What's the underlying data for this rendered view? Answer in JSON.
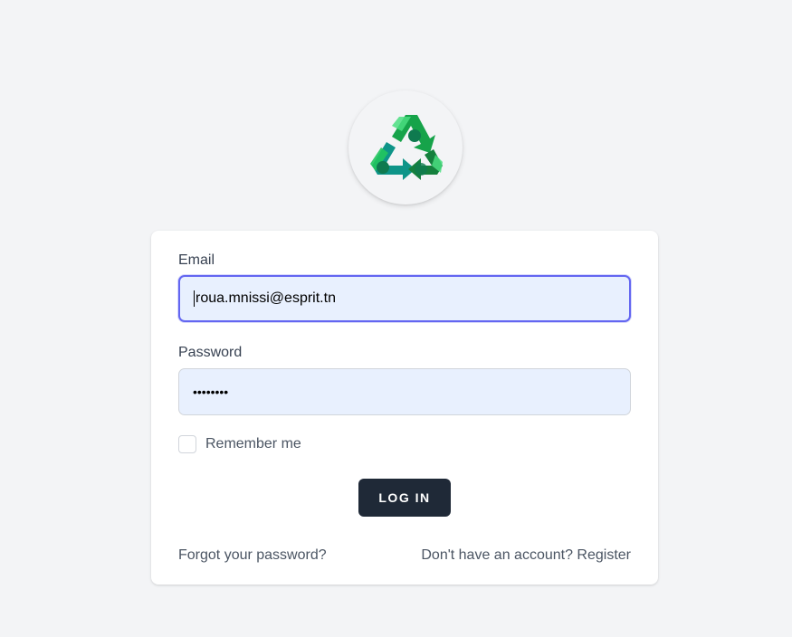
{
  "logo": {
    "icon": "recycle-icon",
    "colors": {
      "dark_green": "#0f7a4f",
      "mid_green": "#16a34a",
      "light_green": "#4ade80",
      "teal": "#0d9488"
    }
  },
  "form": {
    "email_label": "Email",
    "email_value": "roua.mnissi@esprit.tn",
    "password_label": "Password",
    "password_value": "••••••••",
    "remember_label": "Remember me",
    "remember_checked": false,
    "login_label": "LOG IN",
    "forgot_label": "Forgot your password?",
    "register_label": "Don't have an account? Register"
  },
  "colors": {
    "background": "#f3f4f6",
    "card": "#ffffff",
    "input_fill": "#e8f0fe",
    "focus_ring": "#6366f1",
    "button": "#1f2937",
    "text_label": "#374151",
    "text_muted": "#4b5563"
  }
}
